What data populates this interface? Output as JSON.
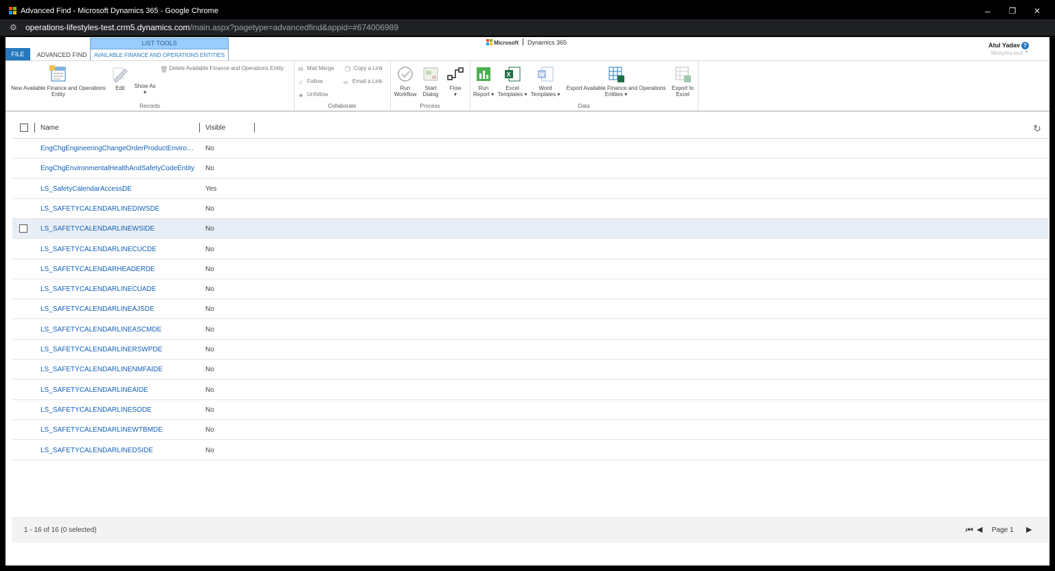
{
  "window": {
    "title": "Advanced Find - Microsoft Dynamics 365 - Google Chrome",
    "minimize": "–",
    "maximize": "❐",
    "close": "✕"
  },
  "address": {
    "host": "operations-lifestyles-test.crm5.dynamics.com",
    "path": "/main.aspx?pagetype=advancedfind&appid=#674006989"
  },
  "tabs": {
    "file": "FILE",
    "advanced_find": "ADVANCED FIND",
    "context_header": "LIST TOOLS",
    "active": "AVAILABLE FINANCE AND OPERATIONS ENTITIES"
  },
  "brand": {
    "microsoft": "Microsoft",
    "product": "Dynamics 365"
  },
  "user": {
    "name": "Atul Yadav",
    "help": "?",
    "org": "lifestyles-test",
    "chevron": "⌃"
  },
  "ribbon": {
    "records": {
      "label": "Records",
      "new": "New Available Finance and Operations Entity",
      "edit": "Edit",
      "show_as": "Show As",
      "delete": "Delete Available Finance and Operations Entity"
    },
    "collaborate": {
      "label": "Collaborate",
      "mail_merge": "Mail Merge",
      "copy_link": "Copy a Link",
      "follow": "Follow",
      "email_link": "Email a Link",
      "unfollow": "Unfollow"
    },
    "process": {
      "label": "Process",
      "run_workflow": "Run Workflow",
      "start_dialog": "Start Dialog",
      "flow": "Flow"
    },
    "data": {
      "label": "Data",
      "run_report": "Run Report",
      "excel_templates": "Excel Templates",
      "word_templates": "Word Templates",
      "export_entities": "Export Available Finance and Operations Entities",
      "export_excel": "Export to Excel"
    }
  },
  "grid": {
    "columns": [
      "Name",
      "Visible"
    ],
    "rows": [
      {
        "name": "EngChgEngineeringChangeOrderProductEnvironmentalHealthAndSafetyEntity",
        "visible": "No"
      },
      {
        "name": "EngChgEnvironmentalHealthAndSafetyCodeEntity",
        "visible": "No"
      },
      {
        "name": "LS_SafetyCalendarAccessDE",
        "visible": "Yes"
      },
      {
        "name": "LS_SAFETYCALENDARLINEDIWSDE",
        "visible": "No"
      },
      {
        "name": "LS_SAFETYCALENDARLINEWSIDE",
        "visible": "No"
      },
      {
        "name": "LS_SAFETYCALENDARLINECUCDE",
        "visible": "No"
      },
      {
        "name": "LS_SAFETYCALENDARHEADERDE",
        "visible": "No"
      },
      {
        "name": "LS_SAFETYCALENDARLINECUADE",
        "visible": "No"
      },
      {
        "name": "LS_SAFETYCALENDARLINEAJSDE",
        "visible": "No"
      },
      {
        "name": "LS_SAFETYCALENDARLINEASCMDE",
        "visible": "No"
      },
      {
        "name": "LS_SAFETYCALENDARLINERSWPDE",
        "visible": "No"
      },
      {
        "name": "LS_SAFETYCALENDARLINENMFAIDE",
        "visible": "No"
      },
      {
        "name": "LS_SAFETYCALENDARLINEAIDE",
        "visible": "No"
      },
      {
        "name": "LS_SAFETYCALENDARLINESODE",
        "visible": "No"
      },
      {
        "name": "LS_SAFETYCALENDARLINEWTBMDE",
        "visible": "No"
      },
      {
        "name": "LS_SAFETYCALENDARLINEDSIDE",
        "visible": "No"
      }
    ],
    "hover_row": 4
  },
  "footer": {
    "count": "1 - 16 of 16 (0 selected)",
    "page": "Page 1"
  },
  "colors": {
    "accent": "#2679bf",
    "link": "#1160b7",
    "context_tab": "#99ccff"
  }
}
